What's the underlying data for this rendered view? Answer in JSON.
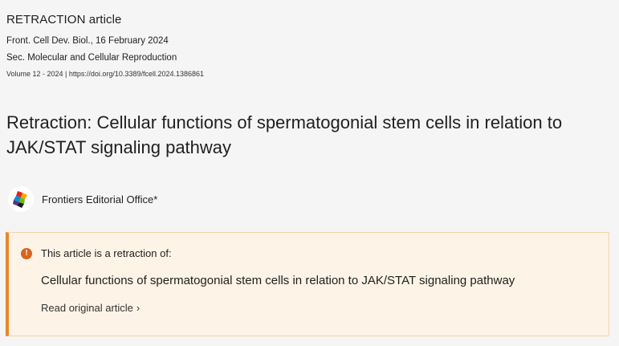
{
  "article": {
    "type_label": "RETRACTION article",
    "journal_line": "Front. Cell Dev. Biol., 16 February 2024",
    "section_line": "Sec. Molecular and Cellular Reproduction",
    "volume_line": "Volume 12 - 2024 | https://doi.org/10.3389/fcell.2024.1386861",
    "title": "Retraction: Cellular functions of spermatogonial stem cells in relation to JAK/STAT signaling pathway"
  },
  "author": {
    "name": "Frontiers Editorial Office*",
    "avatar_icon": "frontiers-logo-icon"
  },
  "notice": {
    "icon": "exclamation-icon",
    "label": "This article is a retraction of:",
    "original_title": "Cellular functions of spermatogonial stem cells in relation to JAK/STAT signaling pathway",
    "read_link": "Read original article",
    "read_link_icon": "chevron-right-icon",
    "accent_color": "#e8862b",
    "background_color": "#fdf3e6"
  }
}
